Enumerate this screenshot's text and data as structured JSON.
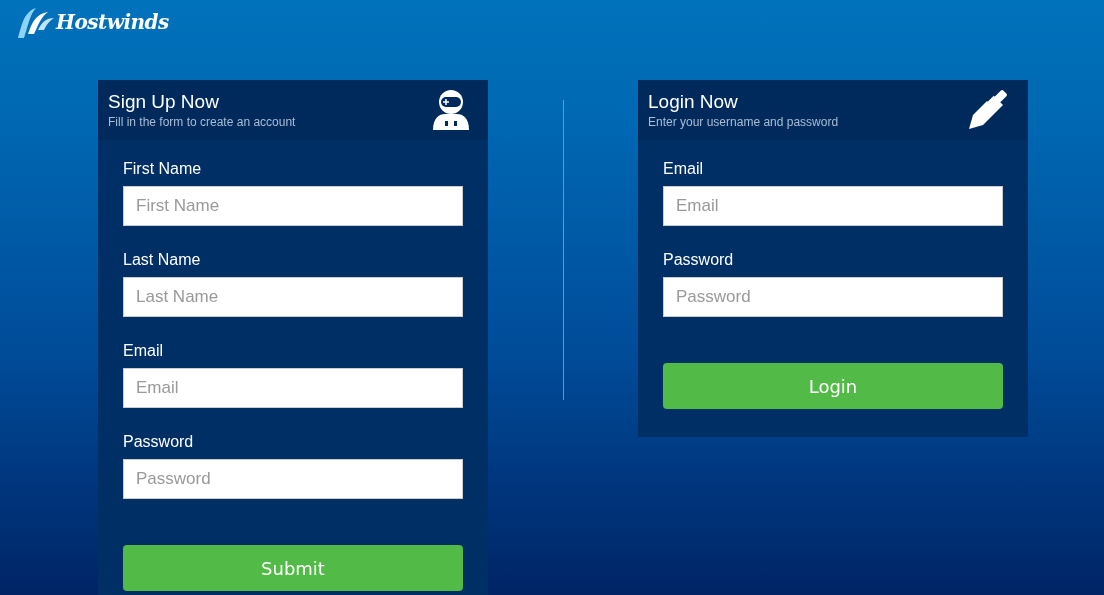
{
  "logo": {
    "text": "Hostwinds"
  },
  "signup": {
    "title": "Sign Up Now",
    "subtitle": "Fill in the form to create an account",
    "fields": [
      {
        "label": "First Name",
        "placeholder": "First Name"
      },
      {
        "label": "Last Name",
        "placeholder": "Last Name"
      },
      {
        "label": "Email",
        "placeholder": "Email"
      },
      {
        "label": "Password",
        "placeholder": "Password"
      }
    ],
    "button": "Submit"
  },
  "login": {
    "title": "Login Now",
    "subtitle": "Enter your username and password",
    "fields": [
      {
        "label": "Email",
        "placeholder": "Email"
      },
      {
        "label": "Password",
        "placeholder": "Password"
      }
    ],
    "button": "Login"
  }
}
